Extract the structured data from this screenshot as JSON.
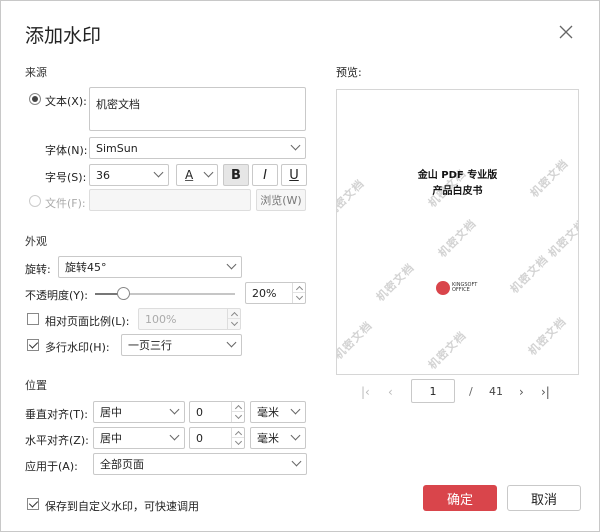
{
  "dialog": {
    "title": "添加水印"
  },
  "source": {
    "section_label": "来源",
    "text_radio_label": "文本(X):",
    "text_value": "机密文档",
    "font_label": "字体(N):",
    "font_value": "SimSun",
    "size_label": "字号(S):",
    "size_value": "36",
    "color_glyph": "A",
    "bold_glyph": "B",
    "italic_glyph": "I",
    "underline_glyph": "U",
    "file_radio_label": "文件(F):",
    "file_value": "",
    "browse_label": "浏览(W)"
  },
  "appearance": {
    "section_label": "外观",
    "rotation_label": "旋转:",
    "rotation_value": "旋转45°",
    "opacity_label": "不透明度(Y):",
    "opacity_value": "20%",
    "opacity_fraction": 0.2,
    "relative_scale_label": "相对页面比例(L):",
    "relative_scale_value": "100%",
    "multiline_label": "多行水印(H):",
    "multiline_value": "一页三行"
  },
  "position": {
    "section_label": "位置",
    "vertical_label": "垂直对齐(T):",
    "vertical_value": "居中",
    "vertical_offset": "0",
    "vertical_unit": "毫米",
    "horizontal_label": "水平对齐(Z):",
    "horizontal_value": "居中",
    "horizontal_offset": "0",
    "horizontal_unit": "毫米",
    "apply_label": "应用于(A):",
    "apply_value": "全部页面"
  },
  "preview": {
    "label": "预览:",
    "doc_title_1": "金山 PDF 专业版",
    "doc_title_2": "产品白皮书",
    "watermark_text": "机密文档",
    "logo_text": "KINGSOFT OFFICE",
    "current_page": "1",
    "page_separator": "/",
    "total_pages": "41"
  },
  "footer": {
    "save_label": "保存到自定义水印，可快速调用",
    "ok_label": "确定",
    "cancel_label": "取消"
  },
  "colors": {
    "accent": "#d9454b",
    "watermark": "#d3d3d3"
  }
}
